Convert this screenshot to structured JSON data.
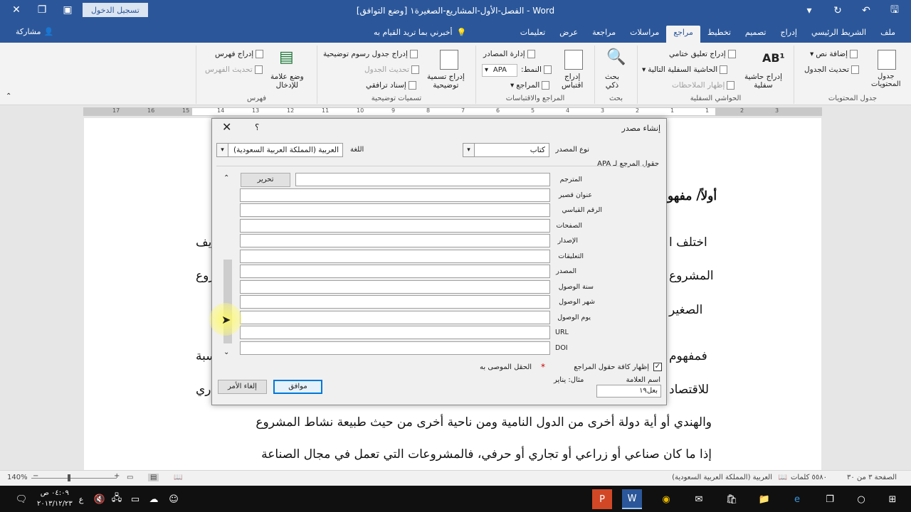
{
  "titlebar": {
    "doc_title": "الفصل-الأول-المشاريع-الصغيرة١ [وضع التوافق] - Word",
    "signin_label": "تسجيل الدخول"
  },
  "tabs": [
    {
      "label": "ملف"
    },
    {
      "label": "الشريط الرئيسي"
    },
    {
      "label": "إدراج"
    },
    {
      "label": "تصميم"
    },
    {
      "label": "تخطيط"
    },
    {
      "label": "مراجع"
    },
    {
      "label": "مراسلات"
    },
    {
      "label": "مراجعة"
    },
    {
      "label": "عرض"
    },
    {
      "label": "تعليمات"
    }
  ],
  "tell_me": "أخبرني بما تريد القيام به",
  "share": "مشاركة",
  "ribbon": {
    "toc": {
      "big_label_1": "جدول",
      "big_label_2": "المحتويات",
      "add_text": "إضافة نص",
      "update_table": "تحديث الجدول",
      "group_label": "جدول المحتويات"
    },
    "footnotes": {
      "insert_footnote_1": "إدراج حاشية",
      "insert_footnote_2": "سفلية",
      "insert_endnote": "إدراج تعليق ختامي",
      "next_footnote": "الحاشية السفلية التالية",
      "show_notes": "إظهار الملاحظات",
      "group_label": "الحواشي السفلية"
    },
    "research": {
      "smart_lookup_1": "بحث",
      "smart_lookup_2": "ذكي",
      "group_label": "بحث"
    },
    "citations": {
      "insert_citation_1": "إدراج",
      "insert_citation_2": "اقتباس",
      "manage_sources": "إدارة المصادر",
      "style_label": "النمط:",
      "style_value": "APA",
      "bibliography": "المراجع",
      "group_label": "المراجع والاقتباسات"
    },
    "captions": {
      "insert_caption_1": "إدراج تسمية",
      "insert_caption_2": "توضيحية",
      "insert_table_figures": "إدراج جدول رسوم توضيحية",
      "update_table": "تحديث الجدول",
      "cross_reference": "إسناد ترافقي",
      "group_label": "تسميات توضيحية"
    },
    "index": {
      "mark_entry_1": "وضع علامة",
      "mark_entry_2": "للإدخال",
      "insert_index": "إدراج فهرس",
      "update_index": "تحديث الفهرس",
      "group_label": "فهرس"
    }
  },
  "ruler": {
    "numbers": [
      "17",
      "16",
      "15",
      "14",
      "13",
      "12",
      "11",
      "10",
      "9",
      "8",
      "7",
      "6",
      "5",
      "4",
      "3",
      "2",
      "1",
      "1",
      "2",
      "3"
    ]
  },
  "document": {
    "heading": "أولاً/ مفهو",
    "lines": [
      "اختلف ا",
      "المشروع",
      "الصغير",
      "فمفهوم",
      "للاقتصاد",
      "والهندي أو أية دولة أخرى من الدول النامية ومن ناحية أخرى من حيث طبيعة نشاط المشروع",
      "إذا ما كان صناعي أو زراعي أو تجاري أو حرفي، فالمشروعات التي تعمل في مجال الصناعة"
    ],
    "right_fragments": [
      "يف",
      "روع",
      "سبة",
      "ري"
    ]
  },
  "dialog": {
    "title": "إنشاء مصدر",
    "help": "؟",
    "source_type_label": "نوع المصدر",
    "source_type_value": "كتاب",
    "language_label": "اللغة",
    "language_value": "العربية (المملكة العربية السعودية)",
    "fields_header": "حقول المرجع لـ APA",
    "edit_button": "تحرير",
    "fields": [
      {
        "label": "المترجم"
      },
      {
        "label": "عنوان قصير"
      },
      {
        "label": "الرقم القياسي"
      },
      {
        "label": "الصفحات"
      },
      {
        "label": "الإصدار"
      },
      {
        "label": "التعليقات"
      },
      {
        "label": "المصدر"
      },
      {
        "label": "سنة الوصول"
      },
      {
        "label": "شهر الوصول"
      },
      {
        "label": "يوم الوصول"
      },
      {
        "label": "URL"
      },
      {
        "label": "DOI"
      }
    ],
    "show_all_label": "إظهار كافة حقول المراجع",
    "recommended_label": "الحقل الموصى به",
    "tag_name_label": "اسم العلامة",
    "example_label": "مثال: يناير",
    "tag_name_value": "بعل١٩",
    "ok_button": "موافق",
    "cancel_button": "إلغاء الأمر"
  },
  "statusbar": {
    "page": "الصفحة ٣ من ٣٠",
    "words": "٥٥٨٠ كلمات",
    "language": "العربية (المملكة العربية السعودية)",
    "zoom": "140%"
  },
  "taskbar": {
    "time": "٠٤:٠٩ ص",
    "date": "٢٠١٣/١٢/٢٣",
    "lang": "ع"
  },
  "colors": {
    "word_blue": "#2b579a",
    "ribbon_bg": "#f3f3f3",
    "dialog_bg": "#f0f0f0",
    "primary_button_border": "#0078d7"
  }
}
